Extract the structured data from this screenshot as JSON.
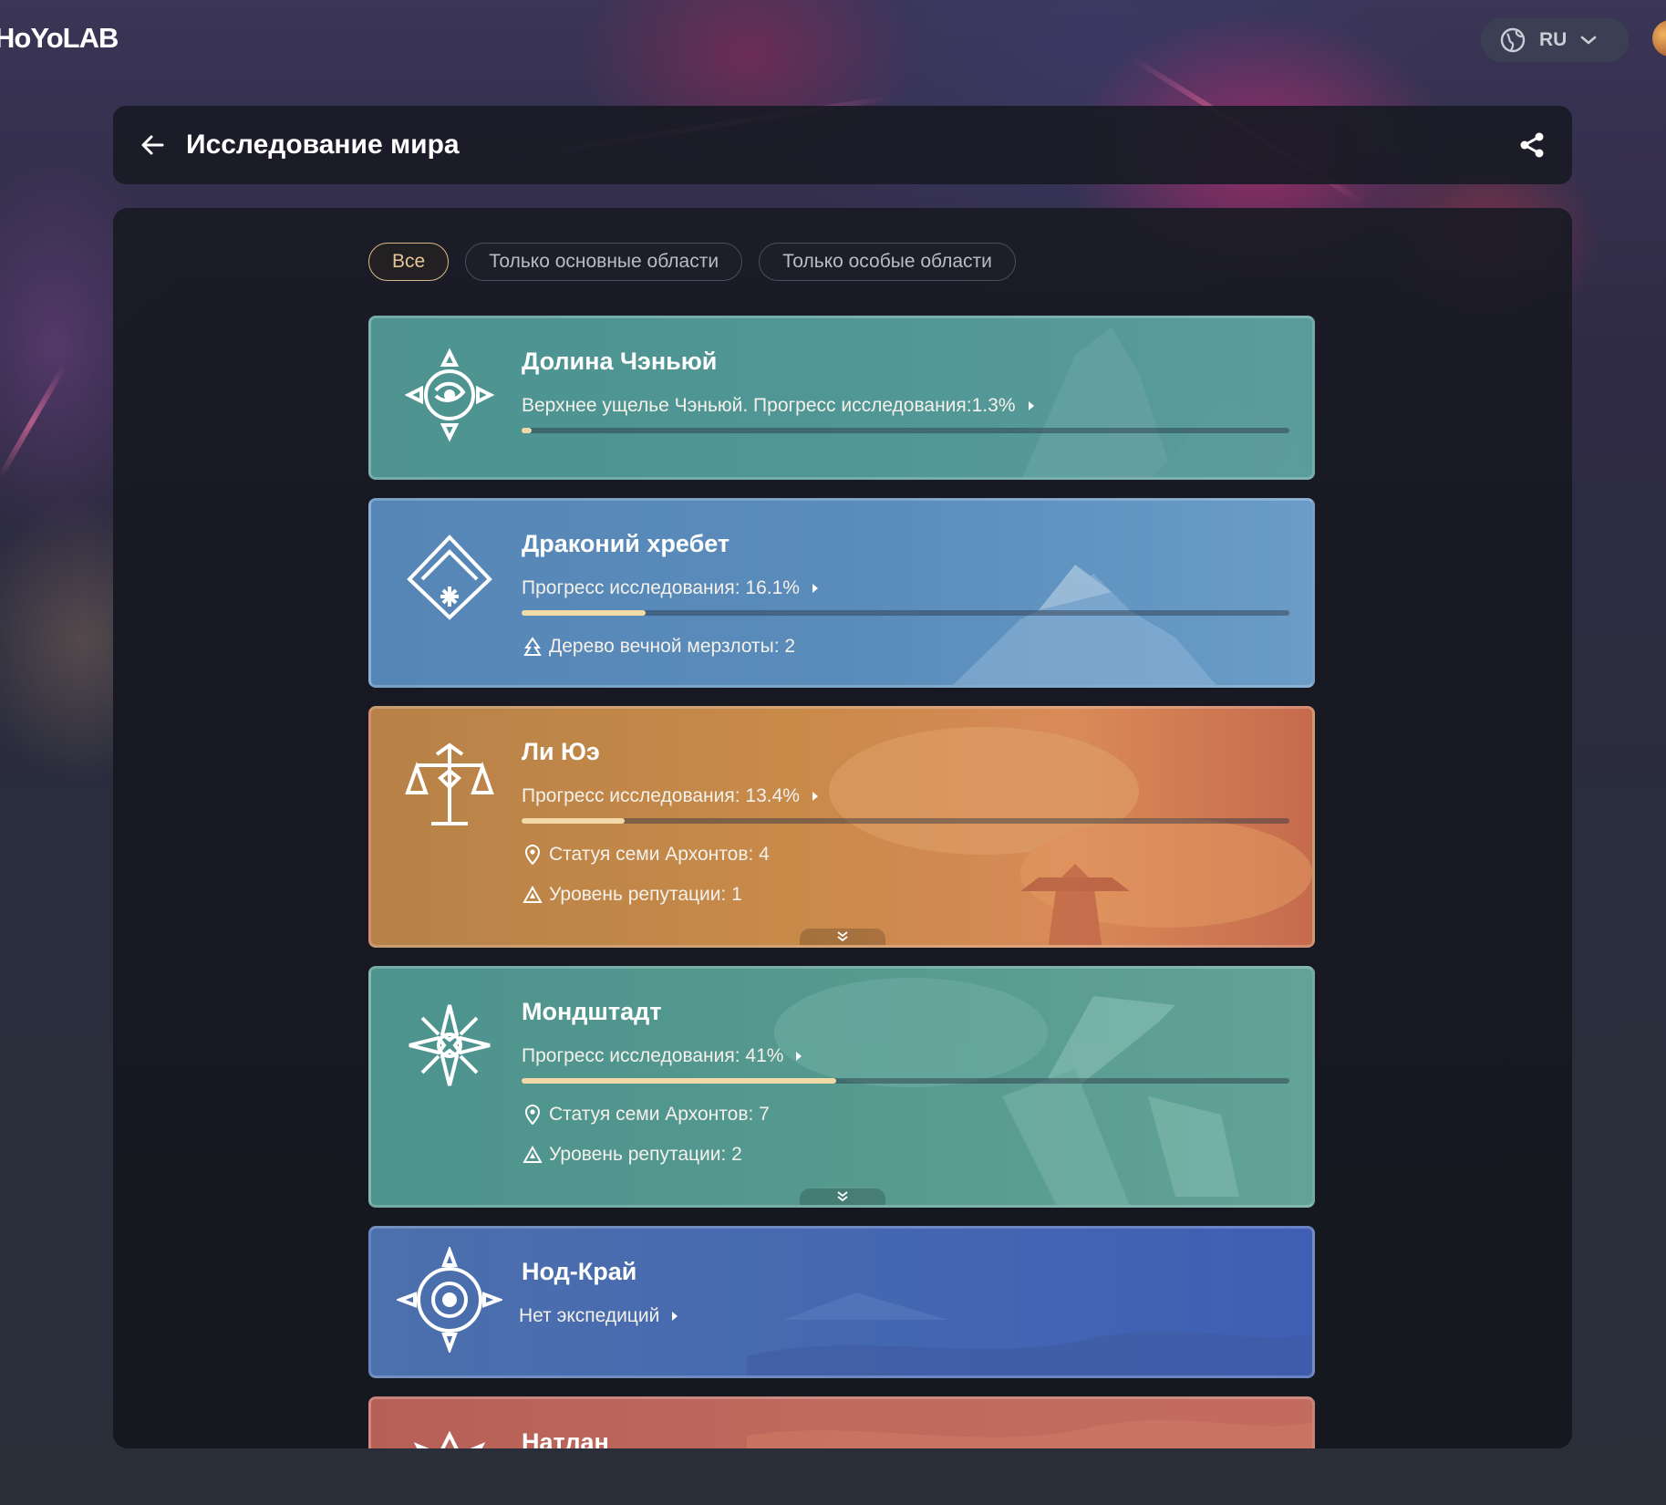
{
  "app": {
    "logo": "HoYoLAB"
  },
  "header": {
    "title": "Исследование мира"
  },
  "language": {
    "current": "RU"
  },
  "filters": [
    {
      "label": "Все",
      "active": true
    },
    {
      "label": "Только основные области",
      "active": false
    },
    {
      "label": "Только особые области",
      "active": false
    }
  ],
  "regions": [
    {
      "name": "Долина Чэньюй",
      "progress_text": "Верхнее ущелье Чэньюй. Прогресс исследования:1.3%",
      "progress": 1.3,
      "stats": []
    },
    {
      "name": "Драконий хребет",
      "progress_text": "Прогресс исследования: 16.1%",
      "progress": 16.1,
      "stats": [
        {
          "icon": "frostbearing-tree-icon",
          "text": "Дерево вечной мерзлоты: 2"
        }
      ]
    },
    {
      "name": "Ли Юэ",
      "progress_text": "Прогресс исследования: 13.4%",
      "progress": 13.4,
      "stats": [
        {
          "icon": "statue-pin-icon",
          "text": "Статуя семи Архонтов: 4"
        },
        {
          "icon": "reputation-icon",
          "text": "Уровень репутации: 1"
        }
      ]
    },
    {
      "name": "Мондштадт",
      "progress_text": "Прогресс исследования: 41%",
      "progress": 41,
      "stats": [
        {
          "icon": "statue-pin-icon",
          "text": "Статуя семи Архонтов: 7"
        },
        {
          "icon": "reputation-icon",
          "text": "Уровень репутации: 2"
        }
      ]
    },
    {
      "name": "Нод-Край",
      "progress_text": "Нет экспедиций",
      "stats": []
    },
    {
      "name": "Натлан",
      "stats": []
    }
  ]
}
